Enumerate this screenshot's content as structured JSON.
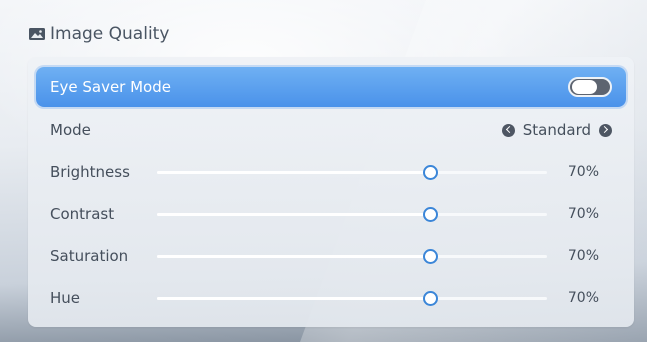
{
  "header": {
    "title": "Image Quality",
    "icon": "image-icon"
  },
  "panel": {
    "eye_saver": {
      "label": "Eye Saver Mode",
      "enabled": false
    },
    "mode": {
      "label": "Mode",
      "value": "Standard"
    },
    "sliders": [
      {
        "label": "Brightness",
        "value": 70,
        "display": "70%"
      },
      {
        "label": "Contrast",
        "value": 70,
        "display": "70%"
      },
      {
        "label": "Saturation",
        "value": 70,
        "display": "70%"
      },
      {
        "label": "Hue",
        "value": 70,
        "display": "70%"
      }
    ]
  },
  "colors": {
    "highlight": "#4a92ea",
    "slider_thumb_border": "#3b86d8",
    "text": "#454f5c"
  }
}
